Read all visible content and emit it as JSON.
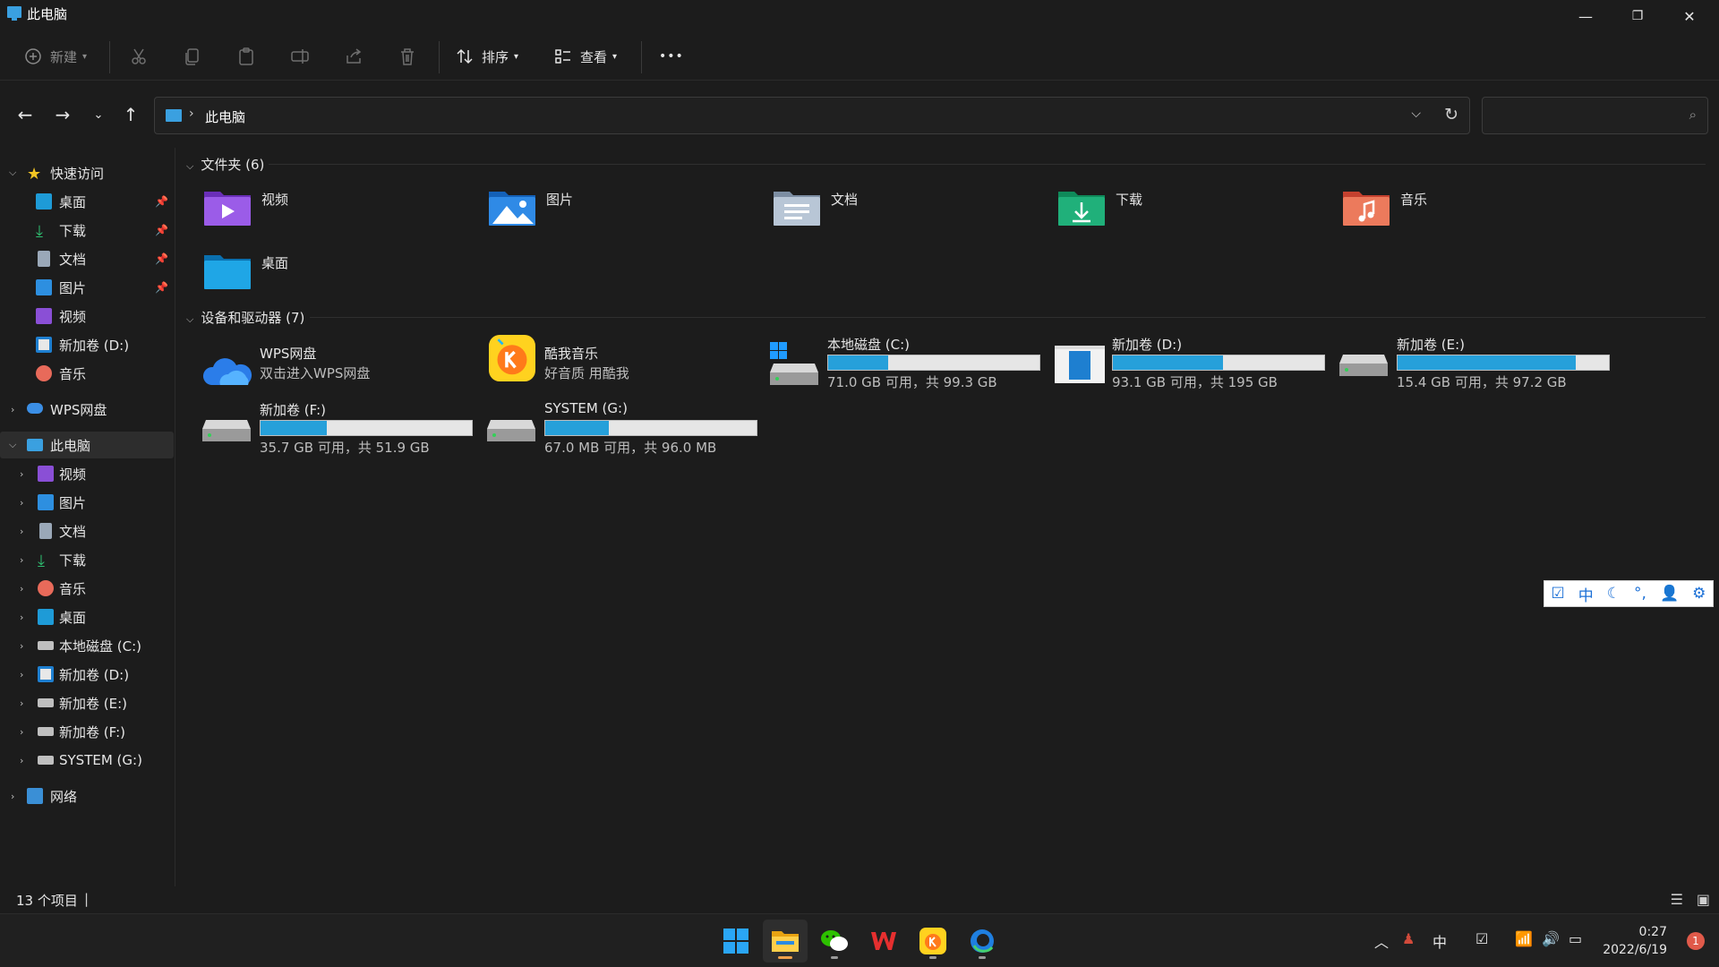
{
  "window": {
    "title": "此电脑",
    "minimize_glyph": "—",
    "restore_glyph": "❐",
    "close_glyph": "✕"
  },
  "command_bar": {
    "new_label": "新建",
    "sort_label": "排序",
    "view_label": "查看",
    "more_glyph": "•••"
  },
  "address_bar": {
    "crumb": "此电脑",
    "search_placeholder": ""
  },
  "sidebar": {
    "quick_access": {
      "label": "快速访问",
      "items": [
        {
          "label": "桌面",
          "pinned": true,
          "icon": "desktop-icon"
        },
        {
          "label": "下载",
          "pinned": true,
          "icon": "download-icon"
        },
        {
          "label": "文档",
          "pinned": true,
          "icon": "document-icon"
        },
        {
          "label": "图片",
          "pinned": true,
          "icon": "picture-icon"
        },
        {
          "label": "视频",
          "pinned": false,
          "icon": "video-icon"
        },
        {
          "label": "新加卷 (D:)",
          "pinned": false,
          "icon": "drive-icon"
        },
        {
          "label": "音乐",
          "pinned": false,
          "icon": "music-icon"
        }
      ]
    },
    "wps_cloud": {
      "label": "WPS网盘"
    },
    "this_pc": {
      "label": "此电脑",
      "items": [
        {
          "label": "视频"
        },
        {
          "label": "图片"
        },
        {
          "label": "文档"
        },
        {
          "label": "下载"
        },
        {
          "label": "音乐"
        },
        {
          "label": "桌面"
        },
        {
          "label": "本地磁盘 (C:)"
        },
        {
          "label": "新加卷 (D:)"
        },
        {
          "label": "新加卷 (E:)"
        },
        {
          "label": "新加卷 (F:)"
        },
        {
          "label": "SYSTEM (G:)"
        }
      ]
    },
    "network": {
      "label": "网络"
    }
  },
  "content": {
    "folders_header": "文件夹 (6)",
    "folders": [
      {
        "name": "视频",
        "icon": "video-folder-icon"
      },
      {
        "name": "图片",
        "icon": "picture-folder-icon"
      },
      {
        "name": "文档",
        "icon": "document-folder-icon"
      },
      {
        "name": "下载",
        "icon": "download-folder-icon"
      },
      {
        "name": "音乐",
        "icon": "music-folder-icon"
      },
      {
        "name": "桌面",
        "icon": "desktop-folder-icon"
      }
    ],
    "drives_header": "设备和驱动器 (7)",
    "apps": [
      {
        "name": "WPS网盘",
        "subtitle": "双击进入WPS网盘",
        "icon": "wps-cloud-icon"
      },
      {
        "name": "酷我音乐",
        "subtitle": "好音质 用酷我",
        "icon": "kuwo-music-icon"
      }
    ],
    "drives": [
      {
        "name": "本地磁盘 (C:)",
        "info": "71.0 GB 可用，共 99.3 GB",
        "used_fraction": 0.285
      },
      {
        "name": "新加卷 (D:)",
        "info": "93.1 GB 可用，共 195 GB",
        "used_fraction": 0.523
      },
      {
        "name": "新加卷 (E:)",
        "info": "15.4 GB 可用，共 97.2 GB",
        "used_fraction": 0.842
      },
      {
        "name": "新加卷 (F:)",
        "info": "35.7 GB 可用，共 51.9 GB",
        "used_fraction": 0.312
      },
      {
        "name": "SYSTEM (G:)",
        "info": "67.0 MB 可用，共 96.0 MB",
        "used_fraction": 0.302
      }
    ]
  },
  "ime_toolbar": {
    "mode_label": "中"
  },
  "status_bar": {
    "item_count": "13 个项目"
  },
  "taskbar": {
    "apps": [
      "start-icon",
      "file-explorer-icon",
      "wechat-icon",
      "wps-office-icon",
      "kuwo-music-icon",
      "edge-icon"
    ],
    "ime_label": "中",
    "time": "0:27",
    "date": "2022/6/19",
    "notification_count": "1"
  },
  "colors": {
    "accent": "#26a0da",
    "background": "#1c1c1c",
    "taskbar": "#202020"
  }
}
